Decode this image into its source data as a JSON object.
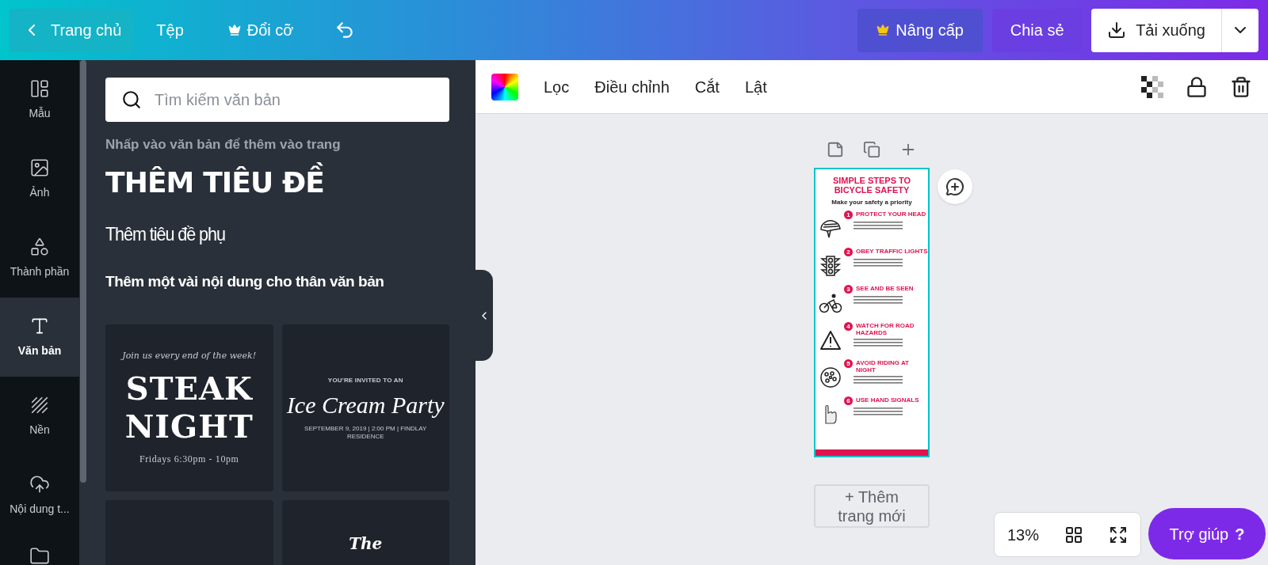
{
  "topbar": {
    "home": "Trang chủ",
    "menu": [
      {
        "label": "Tệp",
        "kind": "text"
      },
      {
        "label": "Đổi cỡ",
        "kind": "crown"
      }
    ],
    "upgrade": "Nâng cấp",
    "share": "Chia sẻ",
    "download": "Tải xuống"
  },
  "rail": [
    {
      "label": "Mẫu",
      "kind": "layout",
      "selected": false
    },
    {
      "label": "Ảnh",
      "kind": "photo",
      "selected": false
    },
    {
      "label": "Thành phần",
      "kind": "shapes",
      "selected": false
    },
    {
      "label": "Văn bản",
      "kind": "text",
      "selected": true
    },
    {
      "label": "Nền",
      "kind": "hatch",
      "selected": false
    },
    {
      "label": "Nội dung t...",
      "kind": "upload",
      "selected": false
    },
    {
      "kind": "folder",
      "selected": false
    }
  ],
  "panel": {
    "search_placeholder": "Tìm kiếm văn bản",
    "hint": "Nhấp vào văn bản để thêm vào trang",
    "heading": "THÊM TIÊU ĐỀ",
    "subheading": "Thêm tiêu đề phụ",
    "body": "Thêm một vài nội dung cho thân văn bản",
    "templates": [
      {
        "kind": "steak",
        "top": "Join us every end of the week!",
        "main": "STEAK NIGHT",
        "bottom": "Fridays 6:30pm - 10pm"
      },
      {
        "kind": "party",
        "top": "YOU'RE INVITED TO AN",
        "main": "Ice Cream Party",
        "bottom": "SEPTEMBER 9, 2019 | 2:00 PM | FINDLAY RESIDENCE"
      },
      {
        "kind": "blank"
      },
      {
        "kind": "yocolat",
        "top": "The"
      }
    ]
  },
  "toolbar": {
    "items": [
      "Lọc",
      "Điều chỉnh",
      "Cắt",
      "Lật"
    ]
  },
  "design": {
    "title": "SIMPLE STEPS TO BICYCLE SAFETY",
    "subtitle": "Make your safety a priority",
    "steps": [
      {
        "number": "1",
        "title": "PROTECT YOUR HEAD",
        "kind": "helmet"
      },
      {
        "number": "2",
        "title": "OBEY TRAFFIC LIGHTS",
        "kind": "traffic"
      },
      {
        "number": "3",
        "title": "SEE AND BE SEEN",
        "kind": "cyclist"
      },
      {
        "number": "4",
        "title": "WATCH FOR ROAD HAZARDS",
        "kind": "warning"
      },
      {
        "number": "5",
        "title": "AVOID RIDING AT NIGHT",
        "kind": "moon"
      },
      {
        "number": "6",
        "title": "USE HAND SIGNALS",
        "kind": "hand"
      }
    ]
  },
  "add_page": "+ Thêm trang mới",
  "zoom": "13%",
  "help": {
    "label": "Trợ giúp",
    "mark": "?"
  }
}
